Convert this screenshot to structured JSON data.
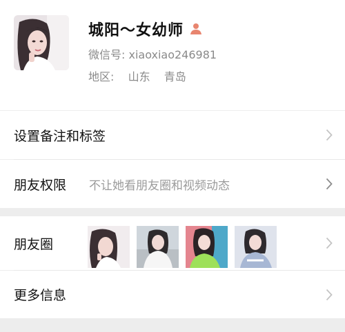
{
  "profile": {
    "name": "城阳～女幼师",
    "wechat_id": "微信号: xiaoxiao246981",
    "region_label": "地区:",
    "region_province": "山东",
    "region_city": "青岛",
    "gender_icon": "female-person-icon"
  },
  "rows": {
    "remark_label": "设置备注和标签",
    "permission_label": "朋友权限",
    "permission_value": "不让她看朋友圈和视频动态",
    "moments_label": "朋友圈",
    "more_info_label": "更多信息"
  },
  "colors": {
    "background": "#ededed",
    "card": "#ffffff",
    "gender_icon": "#e8856f",
    "secondary_text": "#8a8a8a"
  }
}
